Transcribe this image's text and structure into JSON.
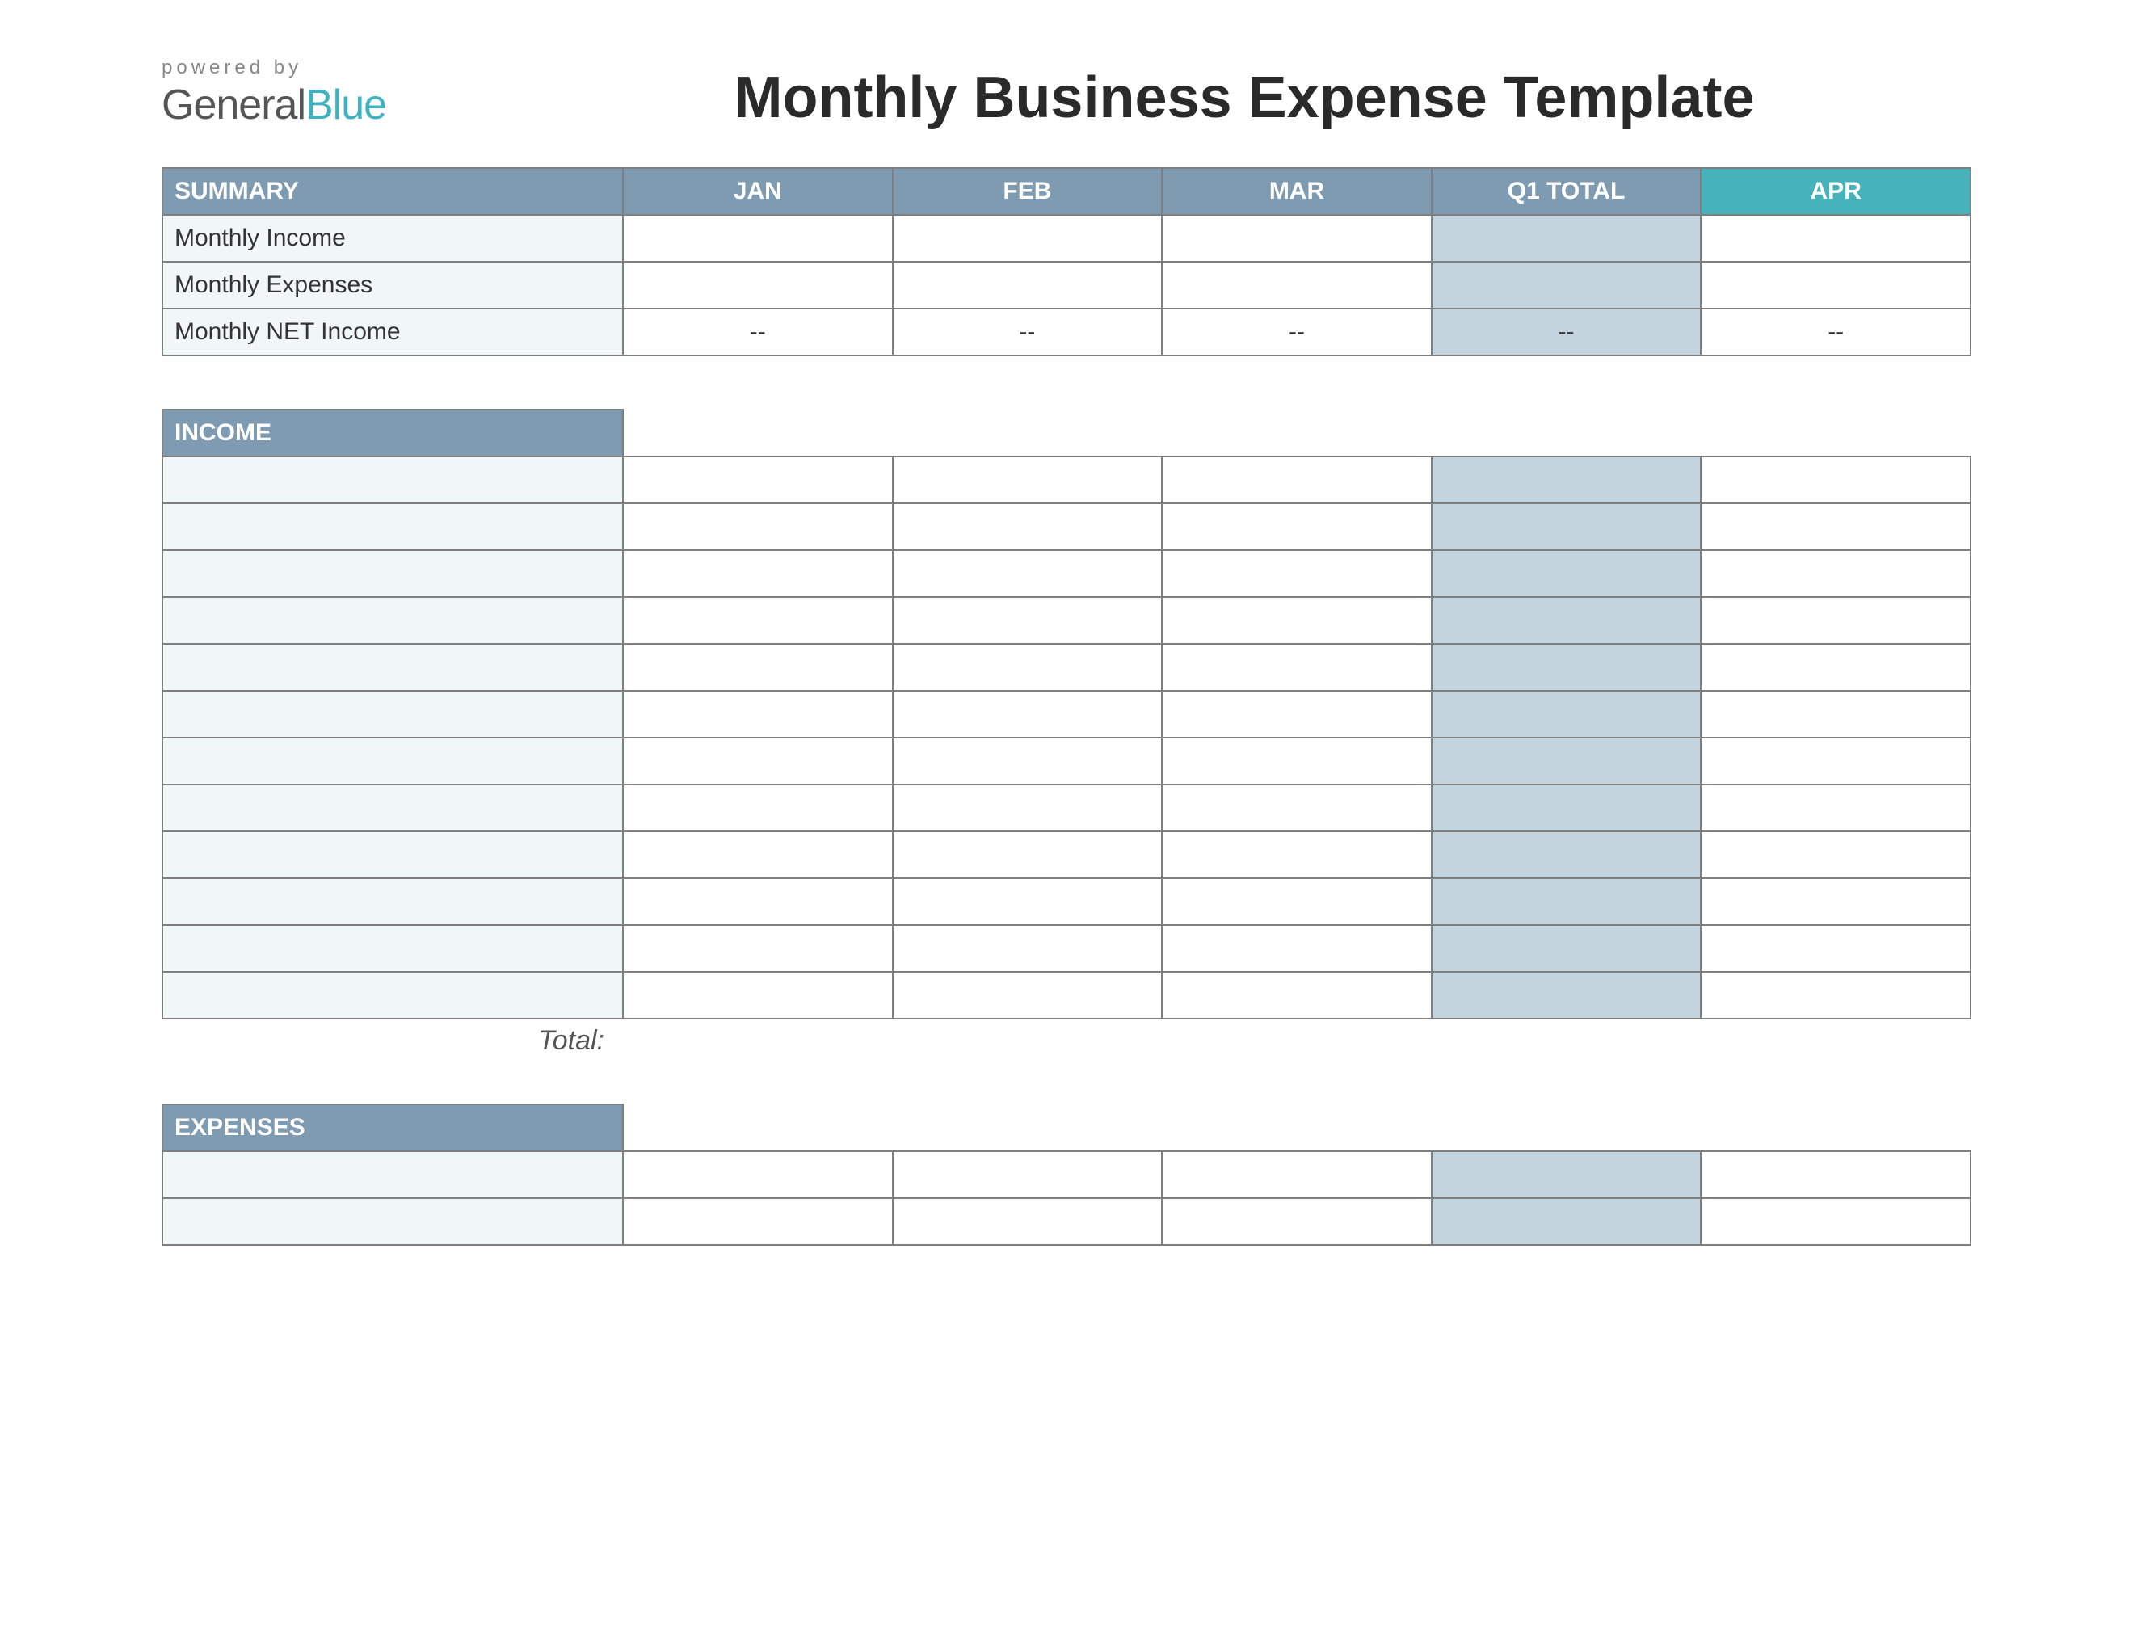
{
  "brand": {
    "powered": "powered by",
    "name1": "General",
    "name2": "Blue"
  },
  "title": "Monthly Business Expense Template",
  "columns": {
    "summary": "SUMMARY",
    "jan": "JAN",
    "feb": "FEB",
    "mar": "MAR",
    "q1": "Q1 TOTAL",
    "apr": "APR"
  },
  "summary": {
    "rows": [
      {
        "label": "Monthly Income",
        "jan": "",
        "feb": "",
        "mar": "",
        "q1": "",
        "apr": ""
      },
      {
        "label": "Monthly Expenses",
        "jan": "",
        "feb": "",
        "mar": "",
        "q1": "",
        "apr": ""
      },
      {
        "label": "Monthly NET Income",
        "jan": "--",
        "feb": "--",
        "mar": "--",
        "q1": "--",
        "apr": "--"
      }
    ]
  },
  "income": {
    "header": "INCOME",
    "rows": [
      {
        "label": "",
        "jan": "",
        "feb": "",
        "mar": "",
        "q1": "",
        "apr": ""
      },
      {
        "label": "",
        "jan": "",
        "feb": "",
        "mar": "",
        "q1": "",
        "apr": ""
      },
      {
        "label": "",
        "jan": "",
        "feb": "",
        "mar": "",
        "q1": "",
        "apr": ""
      },
      {
        "label": "",
        "jan": "",
        "feb": "",
        "mar": "",
        "q1": "",
        "apr": ""
      },
      {
        "label": "",
        "jan": "",
        "feb": "",
        "mar": "",
        "q1": "",
        "apr": ""
      },
      {
        "label": "",
        "jan": "",
        "feb": "",
        "mar": "",
        "q1": "",
        "apr": ""
      },
      {
        "label": "",
        "jan": "",
        "feb": "",
        "mar": "",
        "q1": "",
        "apr": ""
      },
      {
        "label": "",
        "jan": "",
        "feb": "",
        "mar": "",
        "q1": "",
        "apr": ""
      },
      {
        "label": "",
        "jan": "",
        "feb": "",
        "mar": "",
        "q1": "",
        "apr": ""
      },
      {
        "label": "",
        "jan": "",
        "feb": "",
        "mar": "",
        "q1": "",
        "apr": ""
      },
      {
        "label": "",
        "jan": "",
        "feb": "",
        "mar": "",
        "q1": "",
        "apr": ""
      },
      {
        "label": "",
        "jan": "",
        "feb": "",
        "mar": "",
        "q1": "",
        "apr": ""
      }
    ],
    "total_label": "Total:"
  },
  "expenses": {
    "header": "EXPENSES",
    "rows": [
      {
        "label": "",
        "jan": "",
        "feb": "",
        "mar": "",
        "q1": "",
        "apr": ""
      },
      {
        "label": "",
        "jan": "",
        "feb": "",
        "mar": "",
        "q1": "",
        "apr": ""
      }
    ]
  }
}
